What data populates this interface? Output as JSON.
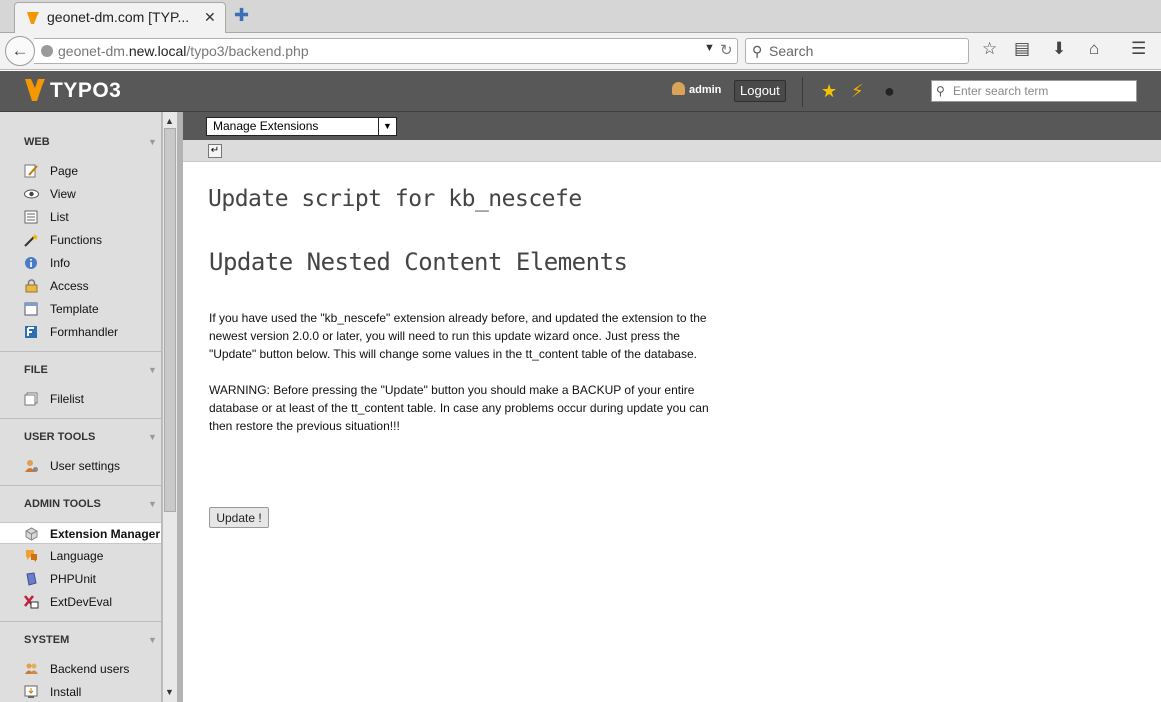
{
  "browser": {
    "tab_title": "geonet-dm.com [TYP...",
    "url_prefix": "geonet-dm.",
    "url_host": "new.local",
    "url_path": "/typo3/backend.php",
    "search_placeholder": "Search"
  },
  "typo3": {
    "logo_text": "TYPO3",
    "username": "admin",
    "logout_label": "Logout",
    "search_placeholder": "Enter search term"
  },
  "menu": {
    "groups": [
      {
        "label": "WEB",
        "items": [
          {
            "label": "Page",
            "icon": "page-edit-icon"
          },
          {
            "label": "View",
            "icon": "eye-icon"
          },
          {
            "label": "List",
            "icon": "list-icon"
          },
          {
            "label": "Functions",
            "icon": "wand-icon"
          },
          {
            "label": "Info",
            "icon": "info-icon"
          },
          {
            "label": "Access",
            "icon": "lock-icon"
          },
          {
            "label": "Template",
            "icon": "template-icon"
          },
          {
            "label": "Formhandler",
            "icon": "form-icon"
          }
        ]
      },
      {
        "label": "FILE",
        "items": [
          {
            "label": "Filelist",
            "icon": "filelist-icon"
          }
        ]
      },
      {
        "label": "USER TOOLS",
        "items": [
          {
            "label": "User settings",
            "icon": "user-settings-icon"
          }
        ]
      },
      {
        "label": "ADMIN TOOLS",
        "items": [
          {
            "label": "Extension Manager",
            "icon": "extension-icon",
            "active": true
          },
          {
            "label": "Language",
            "icon": "language-icon"
          },
          {
            "label": "PHPUnit",
            "icon": "phpunit-icon"
          },
          {
            "label": "ExtDevEval",
            "icon": "extdeveval-icon"
          }
        ]
      },
      {
        "label": "SYSTEM",
        "items": [
          {
            "label": "Backend users",
            "icon": "backend-users-icon"
          },
          {
            "label": "Install",
            "icon": "install-icon"
          }
        ]
      }
    ]
  },
  "docheader": {
    "function_menu_value": "Manage Extensions"
  },
  "main": {
    "title": "Update script for kb_nescefe",
    "subtitle": "Update Nested Content Elements",
    "paragraph1": "If you have used the \"kb_nescefe\" extension already before, and updated the extension to the newest version 2.0.0 or later, you will need to run this update wizard once. Just press the \"Update\" button below. This will change some values in the tt_content table of the database.",
    "paragraph2": "WARNING: Before pressing the \"Update\" button you should make a BACKUP of your entire database or at least of the tt_content table. In case any problems occur during update you can then restore the previous situation!!!",
    "update_button": "Update !"
  },
  "colors": {
    "typo3_orange": "#f49700",
    "topbar": "#585858",
    "menu_bg": "#dedede"
  }
}
